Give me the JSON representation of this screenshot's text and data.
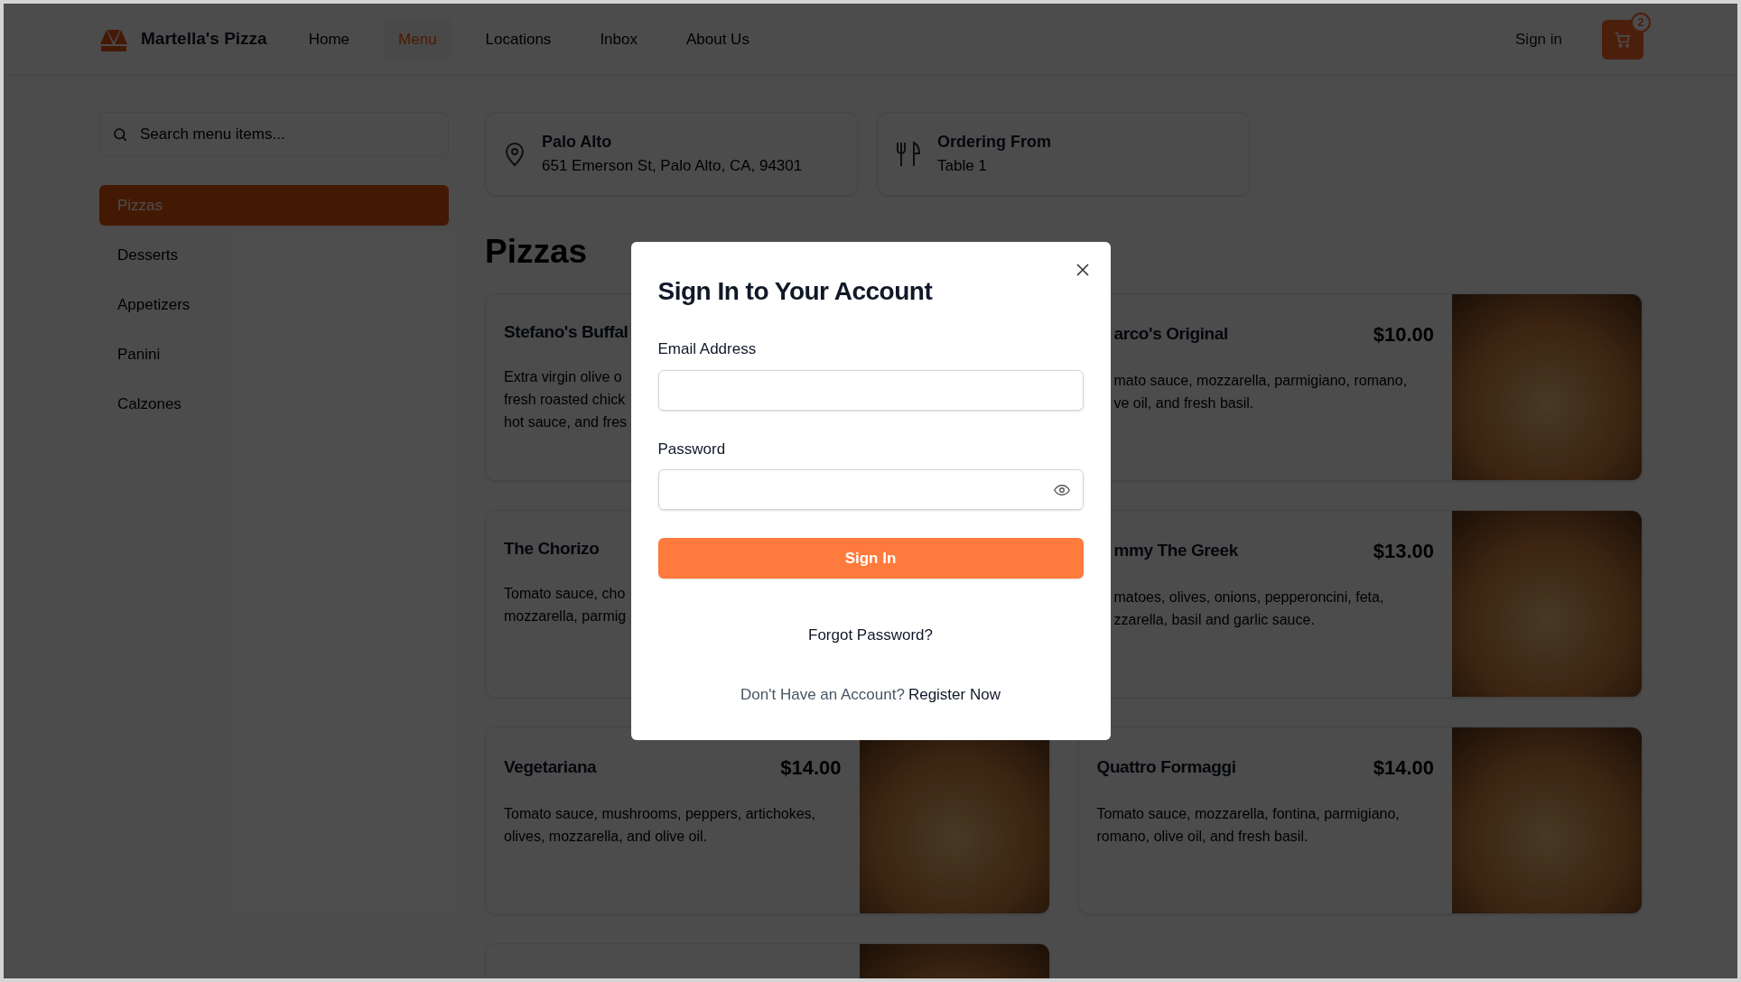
{
  "header": {
    "brand": "Martella's Pizza",
    "nav": [
      {
        "label": "Home",
        "selected": false
      },
      {
        "label": "Menu",
        "selected": true
      },
      {
        "label": "Locations",
        "selected": false
      },
      {
        "label": "Inbox",
        "selected": false
      },
      {
        "label": "About Us",
        "selected": false
      }
    ],
    "sign_in": "Sign in",
    "cart_count": "2"
  },
  "sidebar": {
    "search": {
      "placeholder": "Search menu items..."
    },
    "categories": [
      {
        "label": "Pizzas",
        "selected": true
      },
      {
        "label": "Desserts",
        "selected": false
      },
      {
        "label": "Appetizers",
        "selected": false
      },
      {
        "label": "Panini",
        "selected": false
      },
      {
        "label": "Calzones",
        "selected": false
      }
    ]
  },
  "info_cards": [
    {
      "kind": "location",
      "title": "Palo Alto",
      "subtitle": "651 Emerson St, Palo Alto, CA, 94301"
    },
    {
      "kind": "table",
      "title": "Ordering From",
      "subtitle": "Table 1"
    }
  ],
  "section_title": "Pizzas",
  "menu_items": [
    {
      "kind": "covered_right",
      "name": "Stefano's Buffal",
      "lines": [
        "Extra virgin olive o",
        "fresh roasted chick",
        "hot sauce, and fres"
      ]
    },
    {
      "kind": "covered_left",
      "name": "arco's Original",
      "price": "$10.00",
      "lines": [
        "mato sauce, mozzarella, parmigiano, romano,",
        "ve oil, and fresh basil."
      ]
    },
    {
      "kind": "covered_right",
      "name": "The Chorizo",
      "lines": [
        "Tomato sauce, cho",
        "mozzarella, parmig"
      ]
    },
    {
      "kind": "covered_left",
      "name": "mmy The Greek",
      "price": "$13.00",
      "lines": [
        "matoes, olives, onions, pepperoncini, feta,",
        "zzarella, basil and garlic sauce."
      ]
    },
    {
      "kind": "full",
      "name": "Vegetariana",
      "price": "$14.00",
      "description": "Tomato sauce, mushrooms, peppers, artichokes, olives, mozzarella, and olive oil."
    },
    {
      "kind": "full",
      "name": "Quattro Formaggi",
      "price": "$14.00",
      "description": "Tomato sauce, mozzarella, fontina, parmigiano, romano, olive oil, and fresh basil."
    },
    {
      "kind": "cut_off"
    }
  ],
  "dialog": {
    "title": "Sign In to Your Account",
    "email_label": "Email Address",
    "password_label": "Password",
    "submit": "Sign In",
    "forgot": "Forgot Password?",
    "register_prompt": "Don't Have an Account?",
    "register_link": "Register Now"
  }
}
